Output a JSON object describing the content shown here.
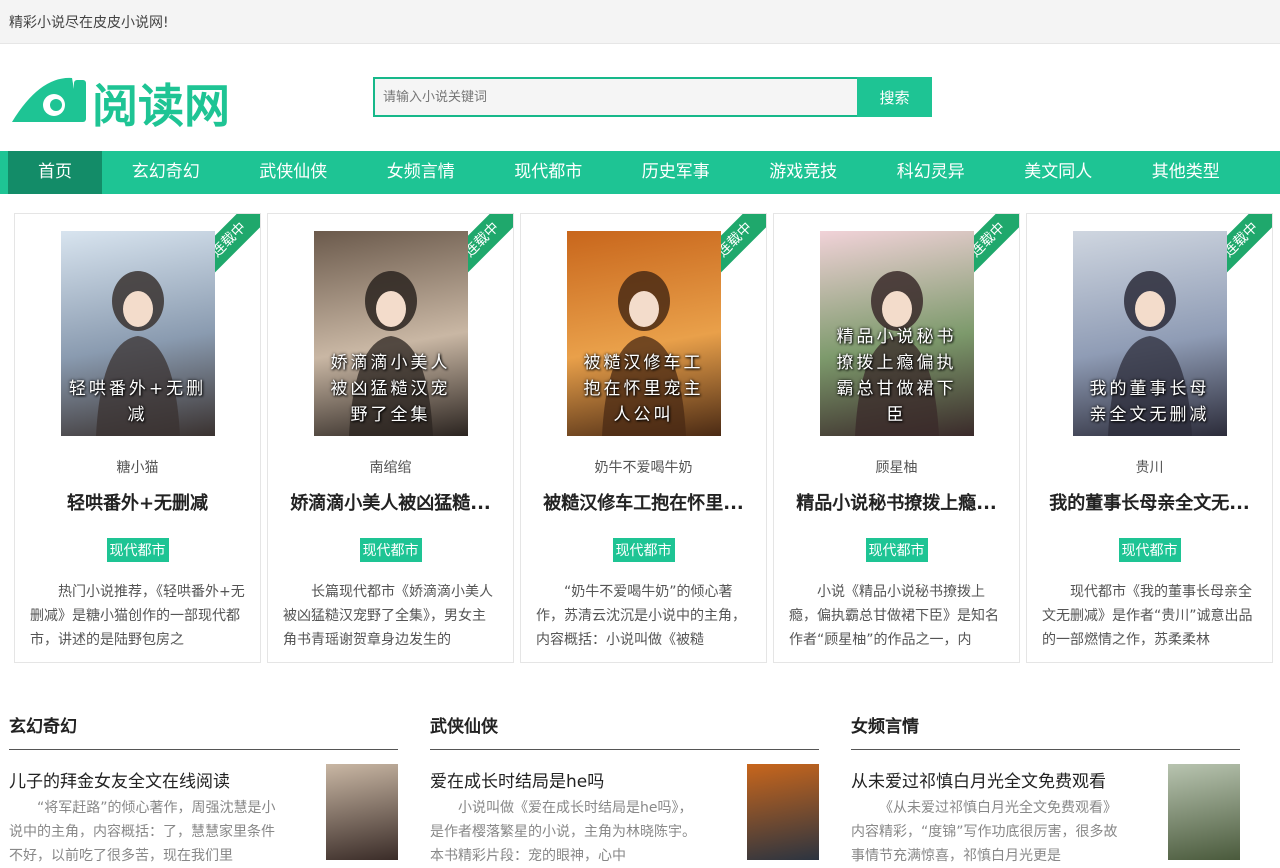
{
  "topbar": {
    "text": "精彩小说尽在皮皮小说网!"
  },
  "logo": {
    "text": "阅读网",
    "color": "#1ec494"
  },
  "search": {
    "placeholder": "请输入小说关键词",
    "button": "搜索"
  },
  "nav": [
    {
      "label": "首页",
      "active": true
    },
    {
      "label": "玄幻奇幻"
    },
    {
      "label": "武侠仙侠"
    },
    {
      "label": "女频言情"
    },
    {
      "label": "现代都市"
    },
    {
      "label": "历史军事"
    },
    {
      "label": "游戏竞技"
    },
    {
      "label": "科幻灵异"
    },
    {
      "label": "美文同人"
    },
    {
      "label": "其他类型"
    }
  ],
  "featured": [
    {
      "badge": "连载中",
      "cover_text": "轻哄番外+无删减",
      "author": "糖小猫",
      "title": "轻哄番外+无删减",
      "tag": "现代都市",
      "desc": "热门小说推荐，《轻哄番外+无删减》是糖小猫创作的一部现代都市，讲述的是陆野包房之"
    },
    {
      "badge": "连载中",
      "cover_text": "娇滴滴小美人被凶猛糙汉宠野了全集",
      "author": "南绾绾",
      "title": "娇滴滴小美人被凶猛糙...",
      "tag": "现代都市",
      "desc": "长篇现代都市《娇滴滴小美人被凶猛糙汉宠野了全集》，男女主角书青瑶谢贺章身边发生的"
    },
    {
      "badge": "连载中",
      "cover_text": "被糙汉修车工抱在怀里宠主人公叫",
      "author": "奶牛不爱喝牛奶",
      "title": "被糙汉修车工抱在怀里...",
      "tag": "现代都市",
      "desc": "“奶牛不爱喝牛奶”的倾心著作，苏清云沈沉是小说中的主角，内容概括：小说叫做《被糙"
    },
    {
      "badge": "连载中",
      "cover_text": "精品小说秘书撩拨上瘾偏执霸总甘做裙下臣",
      "author": "顾星柚",
      "title": "精品小说秘书撩拨上瘾...",
      "tag": "现代都市",
      "desc": "小说《精品小说秘书撩拨上瘾，偏执霸总甘做裙下臣》是知名作者“顾星柚”的作品之一，内"
    },
    {
      "badge": "连载中",
      "cover_text": "我的董事长母亲全文无删减",
      "author": "贵川",
      "title": "我的董事长母亲全文无...",
      "tag": "现代都市",
      "desc": "现代都市《我的董事长母亲全文无删减》是作者“贵川”诚意出品的一部燃情之作，苏柔柔林"
    }
  ],
  "columns": [
    {
      "title": "玄幻奇幻",
      "item": {
        "title": "儿子的拜金女友全文在线阅读",
        "desc": "“将军赶路”的倾心著作，周强沈慧是小说中的主角，内容概括：了，慧慧家里条件不好，以前吃了很多苦，现在我们里"
      }
    },
    {
      "title": "武侠仙侠",
      "item": {
        "title": "爱在成长时结局是he吗",
        "desc": "小说叫做《爱在成长时结局是he吗》，是作者樱落繁星的小说，主角为林晓陈宇。本书精彩片段：宠的眼神，心中"
      }
    },
    {
      "title": "女频言情",
      "item": {
        "title": "从未爱过祁慎白月光全文免费观看",
        "desc": "《从未爱过祁慎白月光全文免费观看》内容精彩，“度锦”写作功底很厉害，很多故事情节充满惊喜，祁慎白月光更是"
      }
    }
  ]
}
